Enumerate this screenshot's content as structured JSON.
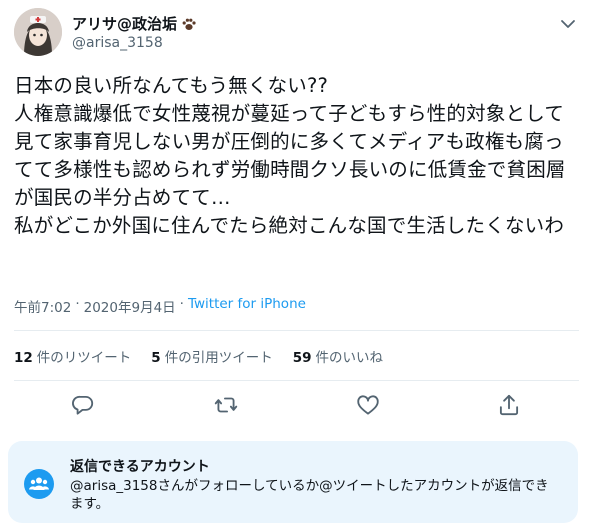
{
  "user": {
    "display_name": "アリサ@政治垢",
    "handle": "@arisa_3158"
  },
  "tweet": {
    "text": "日本の良い所なんてもう無くない??\n人権意識爆低で女性蔑視が蔓延って子どもすら性的対象として見て家事育児しない男が圧倒的に多くてメディアも政権も腐ってて多様性も認められず労働時間クソ長いのに低賃金で貧困層が国民の半分占めてて…\n私がどこか外国に住んでたら絶対こんな国で生活したくないわ",
    "time": "午前7:02",
    "date": "2020年9月4日",
    "dot": "·",
    "source": "Twitter for iPhone"
  },
  "stats": {
    "retweets_count": "12",
    "retweets_label": "件のリツイート",
    "quotes_count": "5",
    "quotes_label": "件の引用ツイート",
    "likes_count": "59",
    "likes_label": "件のいいね"
  },
  "actions": [
    "reply-icon",
    "retweet-icon",
    "like-icon",
    "share-icon"
  ],
  "reply_restriction": {
    "title": "返信できるアカウント",
    "description": "@arisa_3158さんがフォローしているか@ツイートしたアカウントが返信できます。"
  },
  "colors": {
    "accent": "#1d9bf0",
    "text": "#0f1419",
    "secondary": "#536471",
    "notice_bg": "#eaf5fd"
  }
}
